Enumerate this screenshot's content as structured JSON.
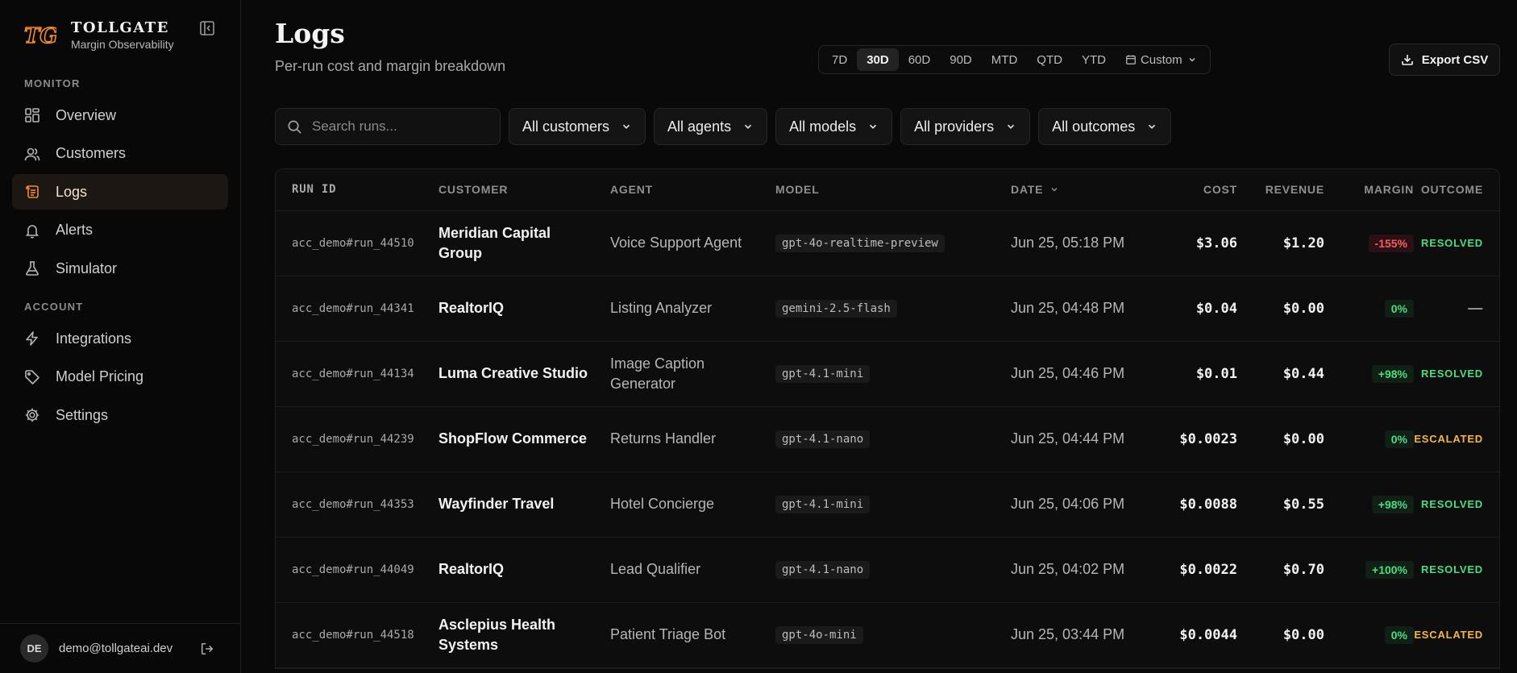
{
  "brand": {
    "logo_text": "TG",
    "name": "TOLLGATE",
    "subtitle": "Margin Observability"
  },
  "sidebar": {
    "sections": [
      {
        "label": "MONITOR",
        "items": [
          {
            "label": "Overview",
            "icon": "grid-icon",
            "active": false
          },
          {
            "label": "Customers",
            "icon": "users-icon",
            "active": false
          },
          {
            "label": "Logs",
            "icon": "scroll-icon",
            "active": true
          },
          {
            "label": "Alerts",
            "icon": "bell-icon",
            "active": false
          },
          {
            "label": "Simulator",
            "icon": "flask-icon",
            "active": false
          }
        ]
      },
      {
        "label": "ACCOUNT",
        "items": [
          {
            "label": "Integrations",
            "icon": "bolt-icon"
          },
          {
            "label": "Model Pricing",
            "icon": "tag-icon"
          },
          {
            "label": "Settings",
            "icon": "gear-icon"
          }
        ]
      }
    ],
    "user": {
      "initials": "DE",
      "email": "demo@tollgateai.dev"
    }
  },
  "header": {
    "title": "Logs",
    "subtitle": "Per-run cost and margin breakdown",
    "ranges": [
      "7D",
      "30D",
      "60D",
      "90D",
      "MTD",
      "QTD",
      "YTD"
    ],
    "active_range": "30D",
    "custom_label": "Custom",
    "export_label": "Export CSV"
  },
  "filters": {
    "search_placeholder": "Search runs...",
    "customers": "All customers",
    "agents": "All agents",
    "models": "All models",
    "providers": "All providers",
    "outcomes": "All outcomes"
  },
  "table": {
    "columns": [
      "RUN ID",
      "CUSTOMER",
      "AGENT",
      "MODEL",
      "DATE",
      "COST",
      "REVENUE",
      "MARGIN",
      "OUTCOME"
    ],
    "rows": [
      {
        "run_id": "acc_demo#run_44510",
        "customer": "Meridian Capital Group",
        "agent": "Voice Support Agent",
        "model": "gpt-4o-realtime-preview",
        "date": "Jun 25, 05:18 PM",
        "cost": "$3.06",
        "revenue": "$1.20",
        "margin": "-155%",
        "outcome": "RESOLVED"
      },
      {
        "run_id": "acc_demo#run_44341",
        "customer": "RealtorIQ",
        "agent": "Listing Analyzer",
        "model": "gemini-2.5-flash",
        "date": "Jun 25, 04:48 PM",
        "cost": "$0.04",
        "revenue": "$0.00",
        "margin": "0%",
        "outcome": "—"
      },
      {
        "run_id": "acc_demo#run_44134",
        "customer": "Luma Creative Studio",
        "agent": "Image Caption Generator",
        "model": "gpt-4.1-mini",
        "date": "Jun 25, 04:46 PM",
        "cost": "$0.01",
        "revenue": "$0.44",
        "margin": "+98%",
        "outcome": "RESOLVED"
      },
      {
        "run_id": "acc_demo#run_44239",
        "customer": "ShopFlow Commerce",
        "agent": "Returns Handler",
        "model": "gpt-4.1-nano",
        "date": "Jun 25, 04:44 PM",
        "cost": "$0.0023",
        "revenue": "$0.00",
        "margin": "0%",
        "outcome": "ESCALATED"
      },
      {
        "run_id": "acc_demo#run_44353",
        "customer": "Wayfinder Travel",
        "agent": "Hotel Concierge",
        "model": "gpt-4.1-mini",
        "date": "Jun 25, 04:06 PM",
        "cost": "$0.0088",
        "revenue": "$0.55",
        "margin": "+98%",
        "outcome": "RESOLVED"
      },
      {
        "run_id": "acc_demo#run_44049",
        "customer": "RealtorIQ",
        "agent": "Lead Qualifier",
        "model": "gpt-4.1-nano",
        "date": "Jun 25, 04:02 PM",
        "cost": "$0.0022",
        "revenue": "$0.70",
        "margin": "+100%",
        "outcome": "RESOLVED"
      },
      {
        "run_id": "acc_demo#run_44518",
        "customer": "Asclepius Health Systems",
        "agent": "Patient Triage Bot",
        "model": "gpt-4o-mini",
        "date": "Jun 25, 03:44 PM",
        "cost": "$0.0044",
        "revenue": "$0.00",
        "margin": "0%",
        "outcome": "ESCALATED"
      }
    ]
  },
  "colors": {
    "accent": "#f28a2e",
    "active_nav_bg": "#1c1712",
    "positive": "#4ade80",
    "negative": "#ff5a5f",
    "warning": "#f5b83d"
  }
}
